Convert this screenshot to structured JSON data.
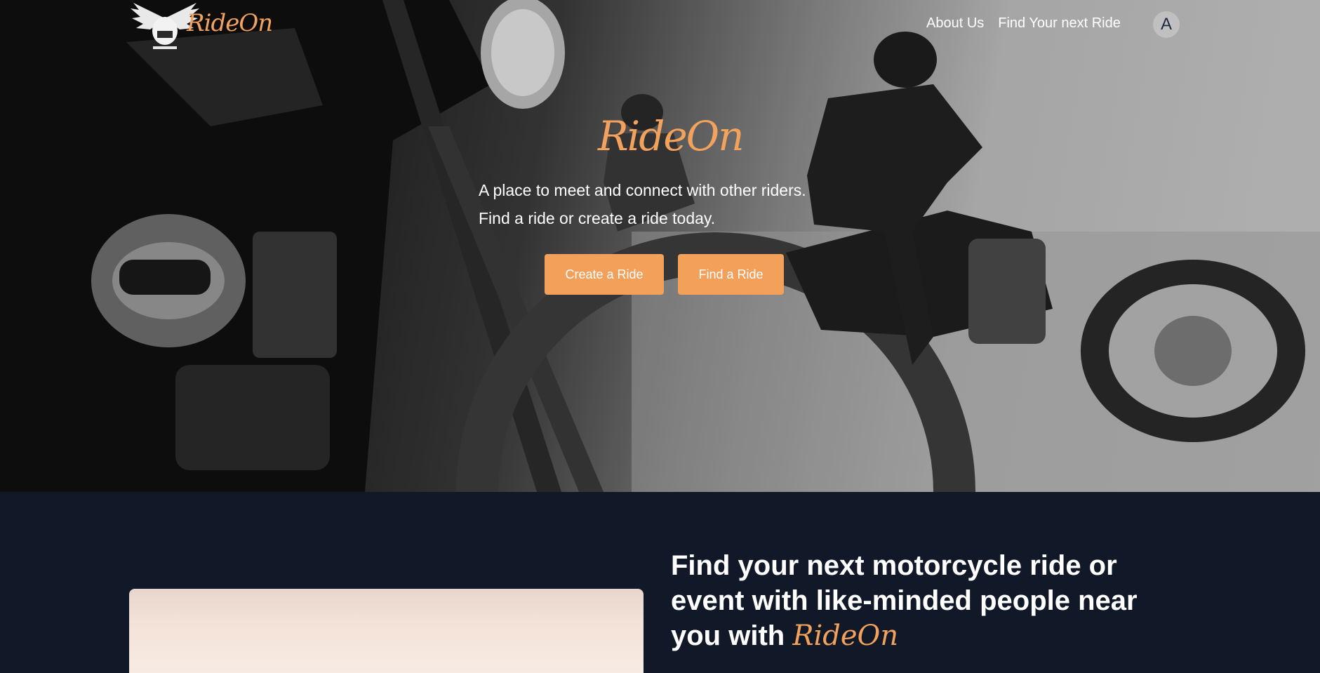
{
  "brand": {
    "name": "RideOn",
    "accent_color": "#f2a25c",
    "logo_icon": "winged-helmet-emblem"
  },
  "nav": {
    "links": [
      {
        "label": "About Us"
      },
      {
        "label": "Find Your next Ride"
      }
    ],
    "avatar_initial": "A"
  },
  "hero": {
    "title": "RideOn",
    "line1": "A place to meet and connect with other riders.",
    "line2": "Find a ride or create a ride today.",
    "buttons": {
      "create": "Create a Ride",
      "find": "Find a Ride"
    },
    "background_image": "grayscale photo of two riders on cruiser motorcycles"
  },
  "section": {
    "heading": "Find your next motorcycle ride or event with like-minded people near you with",
    "brand": "RideOn",
    "image": "sunset sky photo"
  }
}
